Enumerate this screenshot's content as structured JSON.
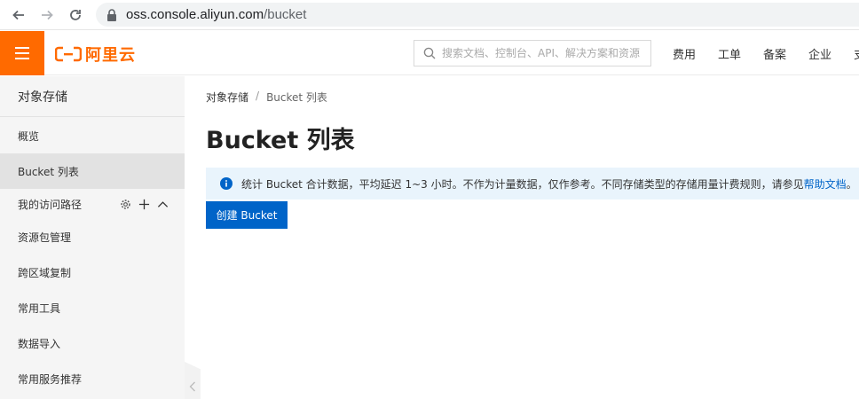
{
  "browser": {
    "url_host": "oss.console.aliyun.com",
    "url_path": "/bucket"
  },
  "header": {
    "logo_text": "阿里云",
    "search_placeholder": "搜索文档、控制台、API、解决方案和资源",
    "nav": [
      "费用",
      "工单",
      "备案",
      "企业",
      "支"
    ]
  },
  "sidebar": {
    "title": "对象存储",
    "items": [
      {
        "label": "概览",
        "active": false
      },
      {
        "label": "Bucket 列表",
        "active": true
      }
    ],
    "group": {
      "label": "我的访问路径"
    },
    "sub_items": [
      "资源包管理",
      "跨区域复制",
      "常用工具",
      "数据导入",
      "常用服务推荐"
    ]
  },
  "main": {
    "breadcrumb": [
      "对象存储",
      "Bucket 列表"
    ],
    "breadcrumb_sep": "/",
    "title": "Bucket 列表",
    "notice_text": "统计 Bucket 合计数据，平均延迟 1~3 小时。不作为计量数据，仅作参考。不同存储类型的存储用量计费规则，请参见",
    "notice_link": "帮助文档",
    "notice_tail": "。",
    "create_button": "创建 Bucket"
  },
  "colors": {
    "brand": "#ff6a00",
    "primary": "#0064c8",
    "notice_bg": "#e9f4fc"
  }
}
